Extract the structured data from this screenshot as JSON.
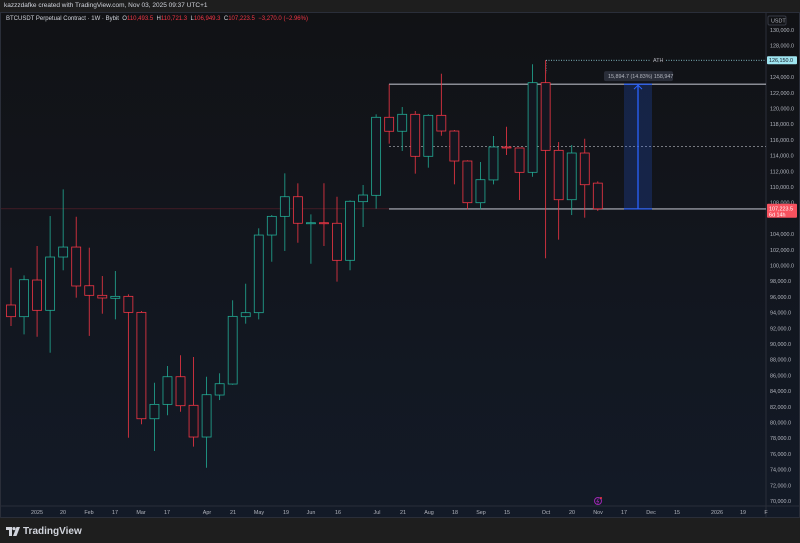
{
  "header": {
    "credit": "kazzzdafke created with TradingView.com, Nov 03, 2025 09:37 UTC+1"
  },
  "legend": {
    "symbol": "BTCUSDT Perpetual Contract · 1W · Bybit",
    "o_label": "O",
    "o": "110,493.5",
    "h_label": "H",
    "h": "110,721.3",
    "l_label": "L",
    "l": "106,949.3",
    "c_label": "C",
    "c": "107,223.5",
    "change": "−3,270.0 (−2.96%)"
  },
  "price_axis": {
    "currency": "USDT",
    "ticks": [
      "130,000.0",
      "128,000.0",
      "124,000.0",
      "122,000.0",
      "120,000.0",
      "118,000.0",
      "116,000.0",
      "114,000.0",
      "112,000.0",
      "110,000.0",
      "108,000.0",
      "104,000.0",
      "102,000.0",
      "100,000.0",
      "98,000.0",
      "96,000.0",
      "94,000.0",
      "92,000.0",
      "90,000.0",
      "88,000.0",
      "86,000.0",
      "84,000.0",
      "82,000.0",
      "80,000.0",
      "78,000.0",
      "76,000.0",
      "74,000.0",
      "72,000.0",
      "70,000.0"
    ],
    "ath_label": "126,150.0",
    "last_price": "107,223.5",
    "countdown": "6d 14h"
  },
  "time_axis": {
    "ticks": [
      "2025",
      "20",
      "Feb",
      "17",
      "Mar",
      "17",
      "Apr",
      "21",
      "May",
      "19",
      "Jun",
      "16",
      "Jul",
      "21",
      "Aug",
      "18",
      "Sep",
      "15",
      "Oct",
      "20",
      "Nov",
      "17",
      "Dec",
      "15",
      "2026",
      "19",
      "F"
    ]
  },
  "annotations": {
    "ath_text": "ATH",
    "ath_price": 126150,
    "range_top": 123100,
    "range_mid": 115150,
    "range_bottom": 107205,
    "measure_label": "15,894.7 (14.83%) 158,947"
  },
  "colors": {
    "up": "#22ab94",
    "down": "#f23645",
    "ath": "#9fe5f0",
    "measure": "#2962ff",
    "last_price_bg": "#f7525f"
  },
  "chart_data": {
    "type": "candlestick",
    "interval": "1W",
    "ylim": [
      70000,
      130000
    ],
    "candles": [
      {
        "o": 94970,
        "h": 99720,
        "l": 92290,
        "c": 93480
      },
      {
        "o": 93480,
        "h": 98750,
        "l": 91230,
        "c": 98190
      },
      {
        "o": 98150,
        "h": 102480,
        "l": 90930,
        "c": 94290
      },
      {
        "o": 94290,
        "h": 106300,
        "l": 88890,
        "c": 101080
      },
      {
        "o": 101080,
        "h": 109700,
        "l": 99390,
        "c": 102350
      },
      {
        "o": 102350,
        "h": 106210,
        "l": 95900,
        "c": 97390
      },
      {
        "o": 97420,
        "h": 102270,
        "l": 91030,
        "c": 96200
      },
      {
        "o": 96200,
        "h": 98660,
        "l": 93860,
        "c": 95860
      },
      {
        "o": 95820,
        "h": 99300,
        "l": 93140,
        "c": 96070
      },
      {
        "o": 96070,
        "h": 96330,
        "l": 78060,
        "c": 94030
      },
      {
        "o": 94030,
        "h": 94200,
        "l": 79770,
        "c": 80480
      },
      {
        "o": 80480,
        "h": 85070,
        "l": 76370,
        "c": 82310
      },
      {
        "o": 82310,
        "h": 87190,
        "l": 80920,
        "c": 85830
      },
      {
        "o": 85830,
        "h": 88560,
        "l": 81370,
        "c": 82140
      },
      {
        "o": 82190,
        "h": 88340,
        "l": 76920,
        "c": 78150
      },
      {
        "o": 78150,
        "h": 85830,
        "l": 74240,
        "c": 83540
      },
      {
        "o": 83500,
        "h": 86270,
        "l": 82860,
        "c": 84940
      },
      {
        "o": 84900,
        "h": 95570,
        "l": 84800,
        "c": 93520
      },
      {
        "o": 93480,
        "h": 97680,
        "l": 92590,
        "c": 93990
      },
      {
        "o": 93990,
        "h": 104740,
        "l": 93140,
        "c": 103880
      },
      {
        "o": 103880,
        "h": 106430,
        "l": 100480,
        "c": 106260
      },
      {
        "o": 106260,
        "h": 111740,
        "l": 101850,
        "c": 108760
      },
      {
        "o": 108760,
        "h": 110470,
        "l": 102900,
        "c": 105380
      },
      {
        "o": 105320,
        "h": 106520,
        "l": 100230,
        "c": 105450
      },
      {
        "o": 105450,
        "h": 110470,
        "l": 102480,
        "c": 105320
      },
      {
        "o": 105380,
        "h": 108760,
        "l": 97940,
        "c": 100660
      },
      {
        "o": 100660,
        "h": 108300,
        "l": 99390,
        "c": 108180
      },
      {
        "o": 108130,
        "h": 110250,
        "l": 104900,
        "c": 108980
      },
      {
        "o": 108940,
        "h": 119260,
        "l": 107240,
        "c": 118880
      },
      {
        "o": 118880,
        "h": 123080,
        "l": 115520,
        "c": 117100
      },
      {
        "o": 117100,
        "h": 120190,
        "l": 114590,
        "c": 119260
      },
      {
        "o": 119260,
        "h": 119680,
        "l": 111700,
        "c": 113910
      },
      {
        "o": 113910,
        "h": 119260,
        "l": 112460,
        "c": 119130
      },
      {
        "o": 119130,
        "h": 124430,
        "l": 116530,
        "c": 117130
      },
      {
        "o": 117130,
        "h": 117260,
        "l": 110340,
        "c": 113310
      },
      {
        "o": 113310,
        "h": 113400,
        "l": 107160,
        "c": 108000
      },
      {
        "o": 108000,
        "h": 113180,
        "l": 107160,
        "c": 110930
      },
      {
        "o": 110900,
        "h": 116500,
        "l": 110340,
        "c": 115100
      },
      {
        "o": 115100,
        "h": 117680,
        "l": 114080,
        "c": 114970
      },
      {
        "o": 114970,
        "h": 114970,
        "l": 108340,
        "c": 111870
      },
      {
        "o": 111870,
        "h": 125630,
        "l": 111310,
        "c": 123290
      },
      {
        "o": 123290,
        "h": 126150,
        "l": 100920,
        "c": 114670
      },
      {
        "o": 114670,
        "h": 115730,
        "l": 103290,
        "c": 108380
      },
      {
        "o": 108380,
        "h": 115350,
        "l": 106430,
        "c": 114330
      },
      {
        "o": 114330,
        "h": 116150,
        "l": 106090,
        "c": 110290
      },
      {
        "o": 110493.5,
        "h": 110721.3,
        "l": 106949.3,
        "c": 107223.5
      }
    ]
  },
  "footer": {
    "brand": "TradingView"
  }
}
